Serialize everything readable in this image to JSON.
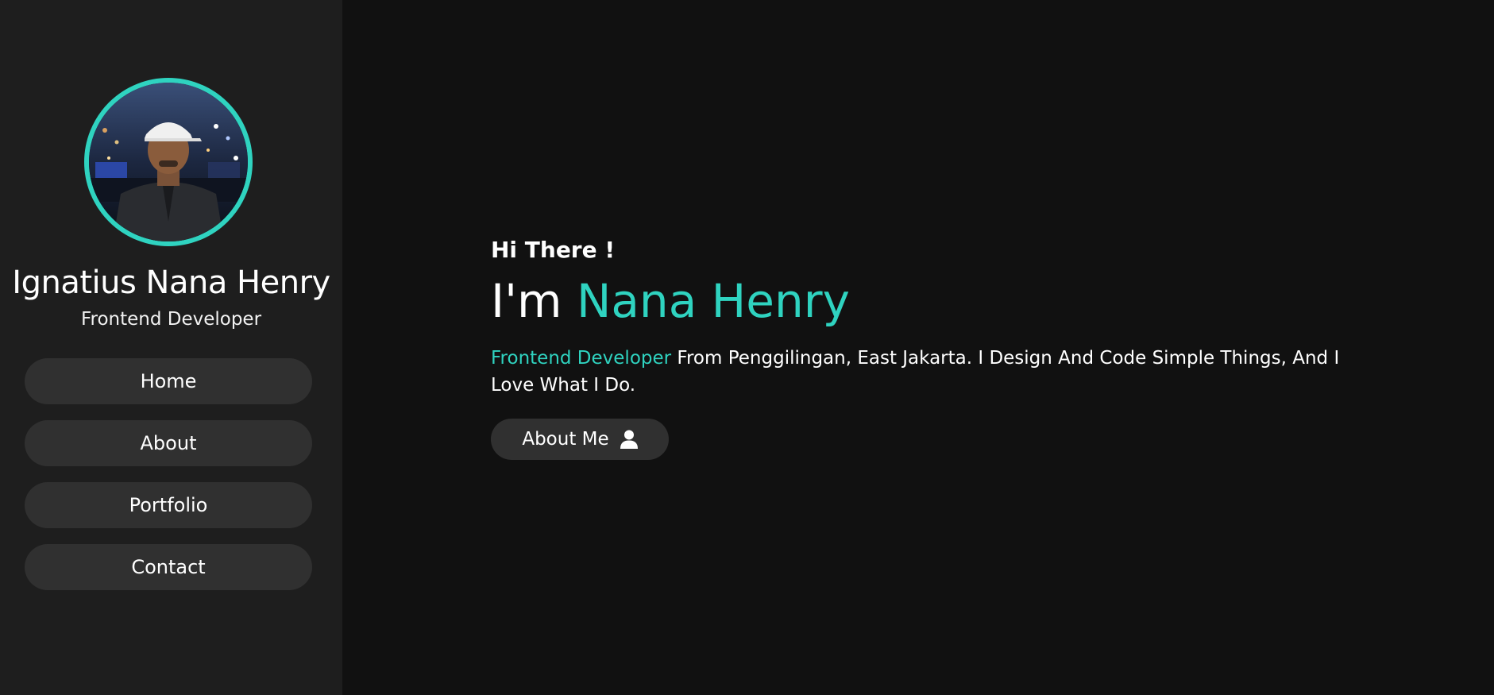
{
  "profile": {
    "name": "Ignatius Nana Henry",
    "role": "Frontend Developer"
  },
  "nav": {
    "items": [
      {
        "label": "Home"
      },
      {
        "label": "About"
      },
      {
        "label": "Portfolio"
      },
      {
        "label": "Contact"
      }
    ]
  },
  "hero": {
    "greeting": "Hi There !",
    "heading_prefix": "I'm ",
    "heading_name": "Nana Henry",
    "desc_highlight": "Frontend Developer",
    "desc_rest": " From Penggilingan, East Jakarta. I Design And Code Simple Things, And I Love What I Do.",
    "about_button_label": "About Me",
    "about_button_icon": "user-icon"
  },
  "colors": {
    "accent": "#2fd3c0",
    "background": "#111111",
    "sidebar": "#1e1e1e",
    "button": "#303030"
  }
}
